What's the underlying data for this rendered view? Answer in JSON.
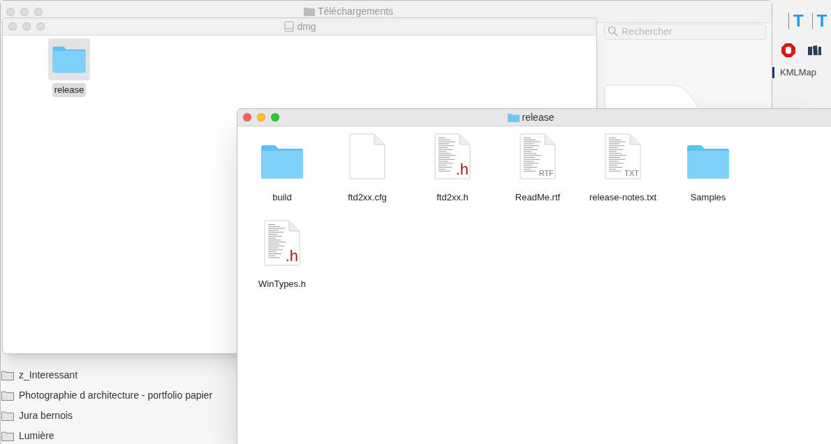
{
  "downloads_window": {
    "title": "Téléchargements",
    "active": false,
    "search": {
      "placeholder": "Rechercher"
    },
    "folders": [
      "z_Interessant",
      "Photographie d architecture - portfolio papier",
      "Jura bernois",
      "Lumière"
    ]
  },
  "side_app": {
    "toolbar_letters": [
      "T",
      "T"
    ],
    "bookmark": "KMLMap"
  },
  "dmg_window": {
    "title": "dmg",
    "active": false,
    "items": [
      {
        "name": "release",
        "kind": "folder",
        "selected": true
      }
    ]
  },
  "release_window": {
    "title": "release",
    "active": true,
    "items": [
      {
        "name": "build",
        "kind": "folder",
        "selected": false
      },
      {
        "name": "ftd2xx.cfg",
        "kind": "blank",
        "selected": false
      },
      {
        "name": "ftd2xx.h",
        "kind": "doc",
        "badge": ".h",
        "selected": false
      },
      {
        "name": "ReadMe.rtf",
        "kind": "doc",
        "badge": "RTF",
        "selected": false
      },
      {
        "name": "release-notes.txt",
        "kind": "doc",
        "badge": "TXT",
        "selected": false
      },
      {
        "name": "Samples",
        "kind": "folder",
        "selected": false
      },
      {
        "name": "WinTypes.h",
        "kind": "doc",
        "badge": ".h",
        "selected": false
      }
    ]
  }
}
